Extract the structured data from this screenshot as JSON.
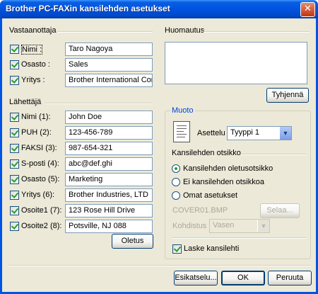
{
  "window": {
    "title": "Brother PC-FAXin kansilehden asetukset",
    "close_glyph": "✕"
  },
  "recipient": {
    "group_title": "Vastaanottaja",
    "fields": [
      {
        "label": "Nimi :",
        "value": "Taro Nagoya",
        "checked": true
      },
      {
        "label": "Osasto :",
        "value": "Sales",
        "checked": true
      },
      {
        "label": "Yritys :",
        "value": "Brother International Corp",
        "checked": true
      }
    ]
  },
  "sender": {
    "group_title": "Lähettäjä",
    "fields": [
      {
        "label": "Nimi (1):",
        "value": "John Doe",
        "checked": true
      },
      {
        "label": "PUH (2):",
        "value": "123-456-789",
        "checked": true
      },
      {
        "label": "FAKSI (3):",
        "value": "987-654-321",
        "checked": true
      },
      {
        "label": "S-posti (4):",
        "value": "abc@def.ghi",
        "checked": true
      },
      {
        "label": "Osasto (5):",
        "value": "Marketing",
        "checked": true
      },
      {
        "label": "Yritys (6):",
        "value": "Brother Industries, LTD",
        "checked": true
      },
      {
        "label": "Osoite1 (7):",
        "value": "123 Rose Hill Drive",
        "checked": true
      },
      {
        "label": "Osoite2 (8):",
        "value": "Potsville, NJ 088",
        "checked": true
      }
    ],
    "default_button": "Oletus"
  },
  "comment": {
    "group_title": "Huomautus",
    "value": "",
    "clear_button": "Tyhjennä"
  },
  "format": {
    "group_title": "Muoto",
    "layout_label": "Asettelu",
    "layout_value": "Tyyppi 1",
    "cover_title_label": "Kansilehden otsikko",
    "options": [
      {
        "label": "Kansilehden oletusotsikko",
        "selected": true
      },
      {
        "label": "Ei kansilehden otsikkoa",
        "selected": false
      },
      {
        "label": "Omat asetukset",
        "selected": false
      }
    ],
    "file_name": "COVER01.BMP",
    "browse_button": "Selaa...",
    "alignment_label": "Kohdistus",
    "alignment_value": "Vasen",
    "count_checkbox": "Laske kansilehti",
    "count_checked": true
  },
  "footer": {
    "preview_button": "Esikatselu...",
    "ok_button": "OK",
    "cancel_button": "Peruuta"
  }
}
